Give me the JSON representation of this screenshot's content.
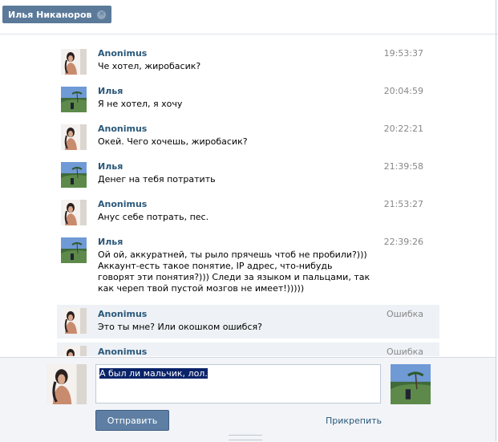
{
  "chat_tab": {
    "name": "Илья Никаноров"
  },
  "messages": [
    {
      "author": "Anonimus",
      "time": "19:53:37",
      "text": "Че хотел, жиробасик?",
      "avatar": "female-avatar",
      "error": false
    },
    {
      "author": "Илья",
      "time": "20:04:59",
      "text": "Я не хотел, я хочу",
      "avatar": "landscape-avatar",
      "error": false
    },
    {
      "author": "Anonimus",
      "time": "20:22:21",
      "text": "Окей. Чего хочешь, жиробасик?",
      "avatar": "female-avatar",
      "error": false
    },
    {
      "author": "Илья",
      "time": "21:39:58",
      "text": "Денег на тебя потратить",
      "avatar": "landscape-avatar",
      "error": false
    },
    {
      "author": "Anonimus",
      "time": "21:53:27",
      "text": "Анус себе потрать, пес.",
      "avatar": "female-avatar",
      "error": false
    },
    {
      "author": "Илья",
      "time": "22:39:26",
      "text": "Ой ой, аккуратней, ты рыло прячешь чтоб не пробили?))) Аккаунт-есть такое понятие, IP адрес, что-нибудь говорят эти понятия?))) Следи за языком и пальцами, так как череп твой пустой мозгов не имеет!)))))",
      "avatar": "landscape-avatar",
      "error": false
    },
    {
      "author": "Anonimus",
      "time": "Ошибка",
      "text": "Это ты мне? Или окошком ошибся?",
      "avatar": "female-avatar",
      "error": true
    },
    {
      "author": "Anonimus",
      "time": "Ошибка",
      "text": "",
      "avatar": "female-avatar",
      "error": true
    }
  ],
  "composer": {
    "input_value": "А был ли мальчик, лол.",
    "send_label": "Отправить",
    "attach_label": "Прикрепить"
  },
  "colors": {
    "accent": "#5b7a9a",
    "link": "#2b587a",
    "error_bg": "#eef1f5"
  }
}
